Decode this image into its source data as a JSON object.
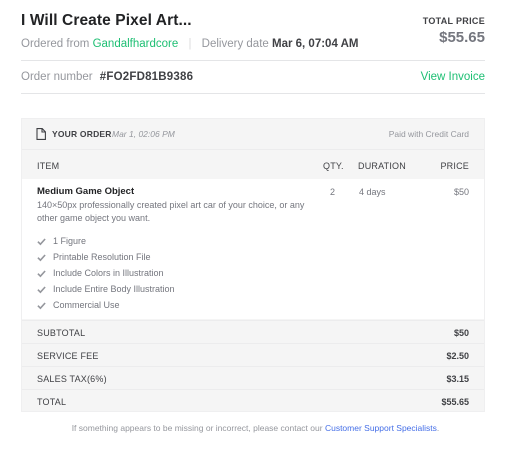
{
  "header": {
    "title": "I Will Create Pixel Art...",
    "ordered_from_label": "Ordered from",
    "seller": "Gandalfhardcore",
    "delivery_label": "Delivery date",
    "delivery_date": "Mar 6, 07:04 AM",
    "total_price_label": "TOTAL PRICE",
    "total_price": "$55.65"
  },
  "order": {
    "number_label": "Order number",
    "number": "#FO2FD81B9386",
    "view_invoice": "View Invoice"
  },
  "card": {
    "heading": "YOUR ORDER",
    "date": "Mar 1, 02:06 PM",
    "payment": "Paid with Credit Card",
    "columns": {
      "item": "ITEM",
      "qty": "QTY.",
      "duration": "DURATION",
      "price": "PRICE"
    },
    "item": {
      "name": "Medium Game Object",
      "description": "140×50px professionally created pixel art car of your choice, or any other game object you want.",
      "qty": "2",
      "duration": "4 days",
      "price": "$50",
      "features": [
        "1 Figure",
        "Printable Resolution File",
        "Include Colors in Illustration",
        "Include Entire Body Illustration",
        "Commercial Use"
      ]
    },
    "summary": [
      {
        "label": "SUBTOTAL",
        "value": "$50"
      },
      {
        "label": "SERVICE FEE",
        "value": "$2.50"
      },
      {
        "label": "SALES TAX(6%)",
        "value": "$3.15"
      },
      {
        "label": "TOTAL",
        "value": "$55.65"
      }
    ]
  },
  "footer": {
    "text": "If something appears to be missing or incorrect, please contact our",
    "link": "Customer Support Specialists",
    "end": "."
  },
  "icons": {
    "document": "document-icon",
    "check": "checkmark-icon"
  },
  "colors": {
    "accent": "#1dbf73",
    "link": "#446ee7",
    "card_bg": "#f5f5f5"
  }
}
